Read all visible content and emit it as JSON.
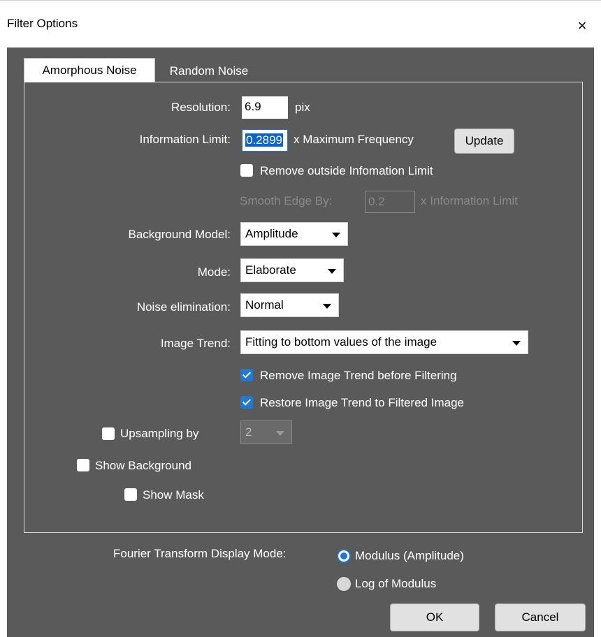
{
  "window": {
    "title": "Filter Options",
    "close_glyph": "×"
  },
  "tabs": [
    {
      "label": "Amorphous Noise",
      "active": true
    },
    {
      "label": "Random Noise",
      "active": false
    }
  ],
  "resolution": {
    "label": "Resolution:",
    "value": "6.9",
    "unit": "pix"
  },
  "information_limit": {
    "label": "Information Limit:",
    "value": "0.2899",
    "suffix": "x Maximum Frequency",
    "update_label": "Update"
  },
  "remove_outside": {
    "label": "Remove outside Infomation Limit",
    "checked": false
  },
  "smooth_edge": {
    "label": "Smooth Edge By:",
    "value": "0.2",
    "suffix": "x Information Limit",
    "enabled": false
  },
  "background_model": {
    "label": "Background Model:",
    "value": "Amplitude"
  },
  "mode": {
    "label": "Mode:",
    "value": "Elaborate"
  },
  "noise_elimination": {
    "label": "Noise elimination:",
    "value": "Normal"
  },
  "image_trend": {
    "label": "Image Trend:",
    "value": "Fitting to bottom values of the image"
  },
  "remove_trend": {
    "label": "Remove Image Trend before Filtering",
    "checked": true
  },
  "restore_trend": {
    "label": "Restore Image Trend to Filtered Image",
    "checked": true
  },
  "upsampling": {
    "label": "Upsampling by",
    "checked": false,
    "value": "2"
  },
  "show_background": {
    "label": "Show Background",
    "checked": false
  },
  "show_mask": {
    "label": "Show Mask",
    "checked": false
  },
  "ft_display": {
    "label": "Fourier Transform Display Mode:",
    "options": [
      {
        "label": "Modulus (Amplitude)",
        "selected": true
      },
      {
        "label": "Log of Modulus",
        "selected": false
      }
    ]
  },
  "buttons": {
    "ok": "OK",
    "cancel": "Cancel"
  },
  "colors": {
    "panel_bg": "#5a5a5a",
    "accent": "#1e78d4",
    "text": "#ffffff",
    "disabled_text": "#8a8a8a"
  }
}
